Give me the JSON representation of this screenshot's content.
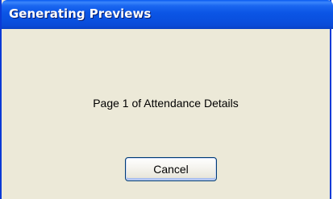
{
  "dialog": {
    "title": "Generating Previews",
    "message": "Page 1 of Attendance Details",
    "cancel_label": "Cancel"
  },
  "colors": {
    "titlebar": "#0a50df",
    "dialog_background": "#ece9d8",
    "title_text": "#ffffff"
  }
}
